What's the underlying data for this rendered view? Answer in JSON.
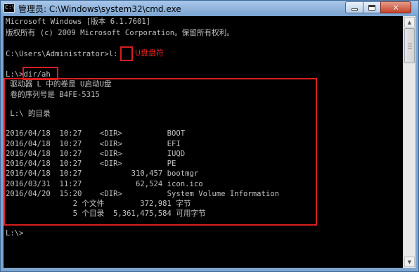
{
  "window": {
    "title": "管理员: C:\\Windows\\system32\\cmd.exe",
    "icon_text": "C:\\",
    "buttons": {
      "minimize": "minimize-icon",
      "maximize": "maximize-icon",
      "close": "✕"
    }
  },
  "console": {
    "lines": [
      "Microsoft Windows [版本 6.1.7601]",
      "版权所有 (c) 2009 Microsoft Corporation。保留所有权利。",
      "",
      "C:\\Users\\Administrator>l:",
      "",
      "L:\\>dir/ah",
      " 驱动器 L 中的卷是 U启动U盘",
      " 卷的序列号是 B4FE-5315",
      "",
      " L:\\ 的目录",
      "",
      "2016/04/18  10:27    <DIR>          BOOT",
      "2016/04/18  10:27    <DIR>          EFI",
      "2016/04/18  10:27    <DIR>          IUQD",
      "2016/04/18  10:27    <DIR>          PE",
      "2016/04/18  10:27           310,457 bootmgr",
      "2016/03/31  11:27            62,524 icon.ico",
      "2016/04/20  15:20    <DIR>          System Volume Information",
      "               2 个文件        372,981 字节",
      "               5 个目录  5,361,475,584 可用字节",
      "",
      "L:\\>"
    ]
  },
  "annotations": {
    "usb_drive_letter": "U盘盘符"
  },
  "colors": {
    "console_bg": "#000000",
    "console_text": "#c0c0c0",
    "highlight": "#d81e1e",
    "annotation_text": "#e0231f",
    "titlebar": "#a9c7ea"
  }
}
